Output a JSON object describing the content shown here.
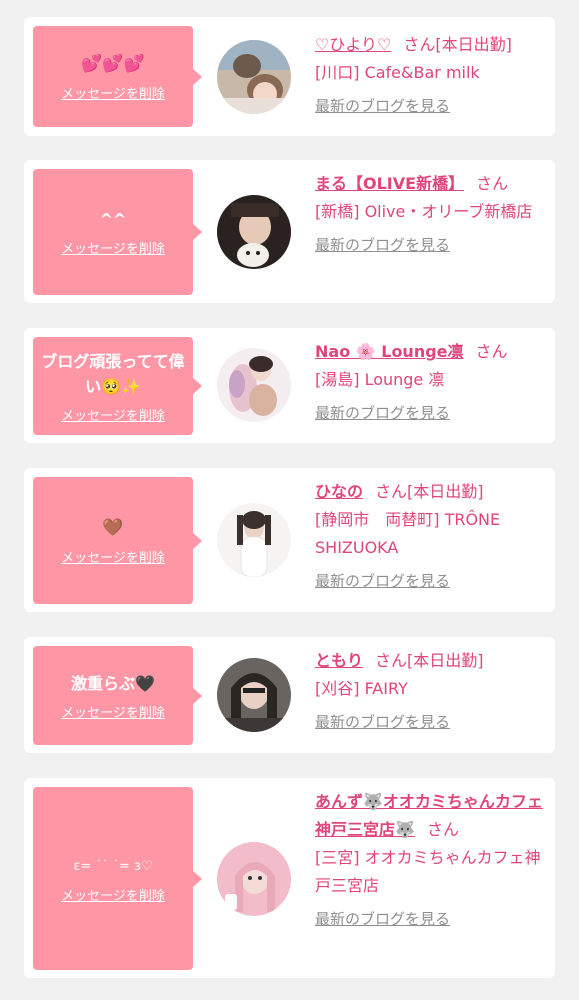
{
  "delete_label": "メッセージを削除",
  "san_label": "さん",
  "blog_link": "最新のブログを見る",
  "colors": {
    "accent": "#e0457b",
    "bubble": "#ff96a6",
    "muted": "#8f8f8f",
    "background": "#f1f1f1"
  },
  "cards": [
    {
      "message": "💕💕💕",
      "name": "♡ひより♡",
      "name_suffix": "[本日出勤]",
      "shop": "[川口] Cafe&Bar milk"
    },
    {
      "message": "^^",
      "name": "まる【OLIVE新橋】",
      "name_suffix": "",
      "shop": "[新橋] Olive・オリーブ新橋店"
    },
    {
      "message": "ブログ頑張ってて偉い🥺✨",
      "name": "Nao 🌸 Lounge凛",
      "name_suffix": "",
      "shop": "[湯島] Lounge 凛"
    },
    {
      "message": "🤎",
      "name": "ひなの",
      "name_suffix": "[本日出勤]",
      "shop": "[静岡市　両替町] TRÔNE SHIZUOKA"
    },
    {
      "message": "激重らぶ🖤",
      "name": "ともり",
      "name_suffix": "[本日出勤]",
      "shop": "[刈谷] FAIRY"
    },
    {
      "message": "ɛ= ˙˙ ˙= ɜ♡",
      "name": "あんず🐺オオカミちゃんカフェ神戸三宮店🐺",
      "name_suffix": "",
      "shop": "[三宮] オオカミちゃんカフェ神戸三宮店"
    }
  ]
}
